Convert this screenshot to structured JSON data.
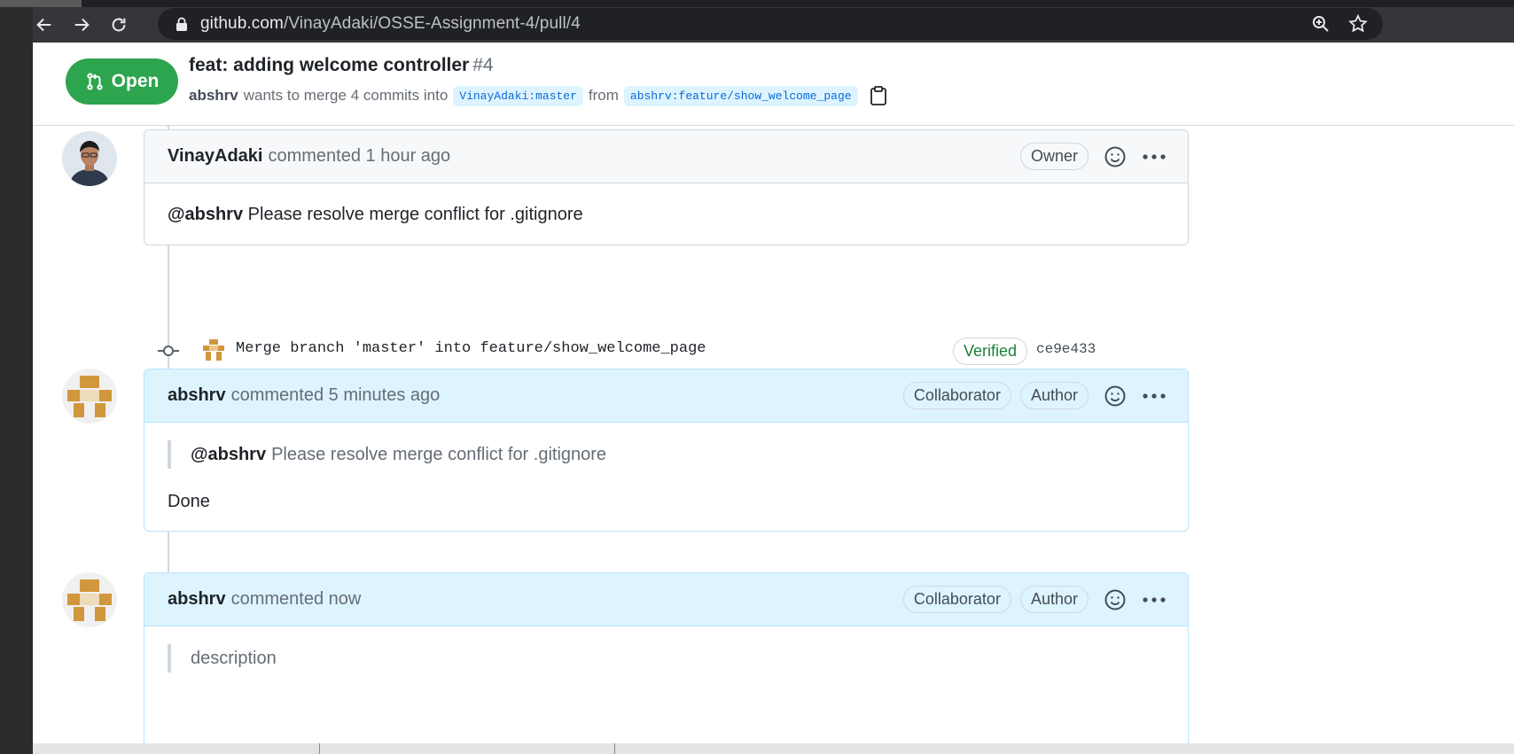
{
  "browser": {
    "url_domain": "github.com",
    "url_path": "/VinayAdaki/OSSE-Assignment-4/pull/4",
    "icons": [
      "back-icon",
      "forward-icon",
      "reload-icon",
      "lock-icon",
      "zoom-icon",
      "star-icon"
    ]
  },
  "pr": {
    "state": "Open",
    "title": "feat: adding welcome controller",
    "number": "#4",
    "author": "abshrv",
    "merge_text": "wants to merge 4 commits into",
    "base_branch": "VinayAdaki:master",
    "from_text": "from",
    "head_branch": "abshrv:feature/show_welcome_page",
    "colors": {
      "open_green": "#2da44e",
      "link_blue": "#0969da"
    }
  },
  "timeline": {
    "comment1": {
      "user": "VinayAdaki",
      "action": "commented 1 hour ago",
      "label": "Owner",
      "mention": "@abshrv",
      "text": "Please resolve merge conflict for .gitignore"
    },
    "commit": {
      "message": "Merge branch 'master' into feature/show_welcome_page",
      "badge": "Verified",
      "sha": "ce9e433"
    },
    "comment2": {
      "user": "abshrv",
      "action": "commented 5 minutes ago",
      "label1": "Collaborator",
      "label2": "Author",
      "quote_mention": "@abshrv",
      "quote_text": "Please resolve merge conflict for .gitignore",
      "text": "Done"
    },
    "comment3": {
      "user": "abshrv",
      "action": "commented now",
      "label1": "Collaborator",
      "label2": "Author",
      "quote_text": "description"
    }
  }
}
